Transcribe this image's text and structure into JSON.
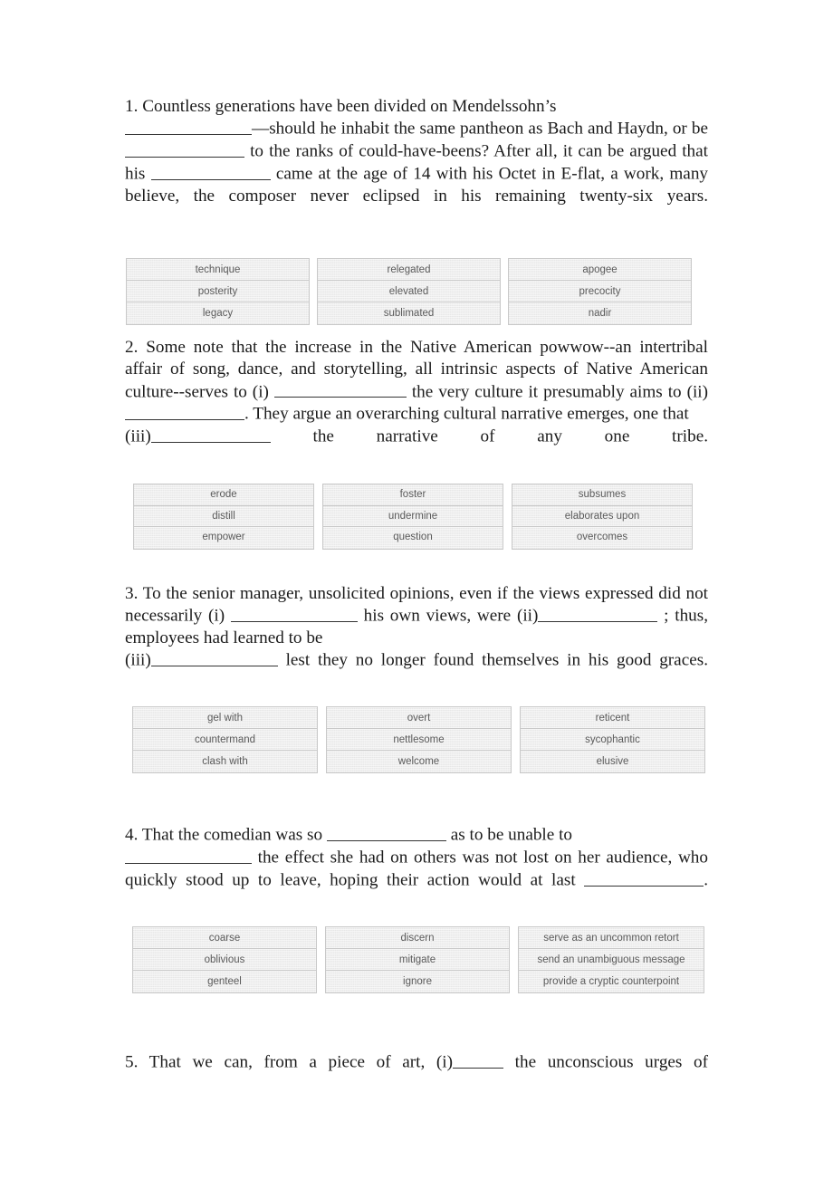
{
  "document": {
    "type": "text-completion-worksheet",
    "page_background": "#ffffff",
    "body_text_color": "#1b1b1b",
    "choice_text_color": "#5a5a5a",
    "choice_cell_background": "#eeeeee",
    "choice_border_color": "#c9c9c9"
  },
  "questions": [
    {
      "number": "1.",
      "text_parts": {
        "p1": "1.  Countless  generations  have  been  divided  on  Mendelssohn’s",
        "p2": "—should he inhabit the same pantheon as Bach and Haydn, or be",
        "p3": "to the ranks of could-have-beens? After all, it can be argued that his",
        "p4": "came at the age of 14 with his Octet in E-flat, a work, many believe, the composer never eclipsed in his remaining twenty-six years."
      },
      "full_text": "1. Countless generations have been divided on Mendelssohn’s _______—should he inhabit the same pantheon as Bach and Haydn, or be _______ to the ranks of could-have-beens? After all, it can be argued that his _______ came at the age of 14 with his Octet in E-flat, a work, many believe, the composer never eclipsed in his remaining twenty-six years.",
      "columns": [
        {
          "blank_label": "",
          "options": [
            "technique",
            "posterity",
            "legacy"
          ]
        },
        {
          "blank_label": "",
          "options": [
            "relegated",
            "elevated",
            "sublimated"
          ]
        },
        {
          "blank_label": "",
          "options": [
            "apogee",
            "precocity",
            "nadir"
          ]
        }
      ]
    },
    {
      "number": "2.",
      "text_parts": {
        "p1": "2. Some note that the increase in the Native American powwow--an intertribal affair of song, dance, and storytelling, all intrinsic aspects of Native American culture--serves to (i)",
        "p2": "the very culture it presumably aims to (ii)",
        "p3": ". They argue an overarching cultural narrative emerges, one that",
        "p4": "(iii)",
        "p5": "the narrative of any one tribe."
      },
      "full_text": "2. Some note that the increase in the Native American powwow--an intertribal affair of song, dance, and storytelling, all intrinsic aspects of Native American culture--serves to (i) _______ the very culture it presumably aims to (ii) _______. They argue an overarching cultural narrative emerges, one that (iii)_______ the narrative of any one tribe.",
      "columns": [
        {
          "blank_label": "(i)",
          "options": [
            "erode",
            "distill",
            "empower"
          ]
        },
        {
          "blank_label": "(ii)",
          "options": [
            "foster",
            "undermine",
            "question"
          ]
        },
        {
          "blank_label": "(iii)",
          "options": [
            "subsumes",
            "elaborates upon",
            "overcomes"
          ]
        }
      ]
    },
    {
      "number": "3.",
      "text_parts": {
        "p1": "3. To the senior manager, unsolicited opinions, even if the views expressed did not necessarily (i)",
        "p2": "his own views, were (ii)",
        "p3": "; thus, employees had learned to be",
        "p4": "(iii)",
        "p5": "lest they no longer found themselves in his good graces."
      },
      "full_text": "3. To the senior manager, unsolicited opinions, even if the views expressed did not necessarily (i) _______ his own views, were (ii)_______ ; thus, employees had learned to be (iii)_______ lest they no longer found themselves in his good graces.",
      "columns": [
        {
          "blank_label": "(i)",
          "options": [
            "gel with",
            "countermand",
            "clash with"
          ]
        },
        {
          "blank_label": "(ii)",
          "options": [
            "overt",
            "nettlesome",
            "welcome"
          ]
        },
        {
          "blank_label": "(iii)",
          "options": [
            "reticent",
            "sycophantic",
            "elusive"
          ]
        }
      ]
    },
    {
      "number": "4.",
      "text_parts": {
        "p1": "4. That the comedian was so",
        "p2": "as to be unable to",
        "p3": "the effect she had on others was not lost on her audience, who quickly stood up to leave, hoping their action would at last",
        "p4": "."
      },
      "full_text": "4. That the comedian was so _______ as to be unable to _______ the effect she had on others was not lost on her audience, who quickly stood up to leave, hoping their action would at last _______.",
      "columns": [
        {
          "blank_label": "",
          "options": [
            "coarse",
            "oblivious",
            "genteel"
          ]
        },
        {
          "blank_label": "",
          "options": [
            "discern",
            "mitigate",
            "ignore"
          ]
        },
        {
          "blank_label": "",
          "options": [
            "serve as an uncommon retort",
            "send an unambiguous message",
            "provide a cryptic counterpoint"
          ]
        }
      ]
    },
    {
      "number": "5.",
      "text_parts": {
        "p1": "5. That we can, from a piece of art, (i)",
        "p2": "the unconscious urges of"
      },
      "full_text": "5. That we can, from a piece of art, (i)______ the unconscious urges of",
      "columns": []
    }
  ]
}
